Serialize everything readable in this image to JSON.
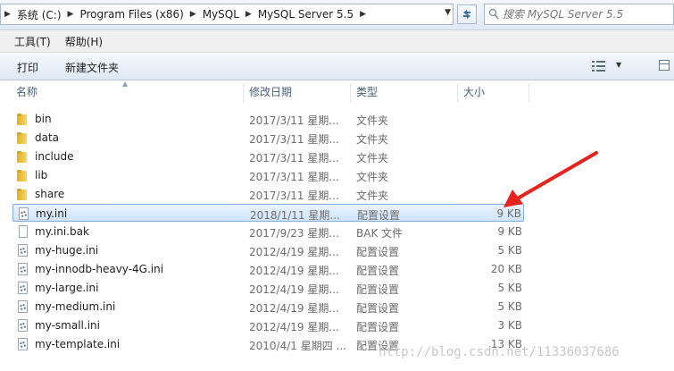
{
  "address_bar": {
    "crumbs": [
      "系统 (C:)",
      "Program Files (x86)",
      "MySQL",
      "MySQL Server 5.5"
    ],
    "search_placeholder": "搜索 MySQL Server 5.5"
  },
  "menu": [
    "工具(T)",
    "帮助(H)"
  ],
  "toolbar": {
    "print_label": "打印",
    "new_folder_label": "新建文件夹"
  },
  "columns": {
    "name": "名称",
    "date": "修改日期",
    "type": "类型",
    "size": "大小"
  },
  "files": [
    {
      "icon": "folder-icon",
      "name": "bin",
      "date": "2017/3/11 星期...",
      "type": "文件夹",
      "size": ""
    },
    {
      "icon": "folder-icon",
      "name": "data",
      "date": "2017/3/11 星期...",
      "type": "文件夹",
      "size": ""
    },
    {
      "icon": "folder-icon",
      "name": "include",
      "date": "2017/3/11 星期...",
      "type": "文件夹",
      "size": ""
    },
    {
      "icon": "folder-icon",
      "name": "lib",
      "date": "2017/3/11 星期...",
      "type": "文件夹",
      "size": ""
    },
    {
      "icon": "folder-icon",
      "name": "share",
      "date": "2017/3/11 星期...",
      "type": "文件夹",
      "size": ""
    },
    {
      "icon": "settings-file-icon",
      "name": "my.ini",
      "date": "2018/1/11 星期...",
      "type": "配置设置",
      "size": "9 KB",
      "selected": true
    },
    {
      "icon": "file-icon",
      "name": "my.ini.bak",
      "date": "2017/9/23 星期...",
      "type": "BAK 文件",
      "size": "9 KB"
    },
    {
      "icon": "settings-file-icon",
      "name": "my-huge.ini",
      "date": "2012/4/19 星期...",
      "type": "配置设置",
      "size": "5 KB"
    },
    {
      "icon": "settings-file-icon",
      "name": "my-innodb-heavy-4G.ini",
      "date": "2012/4/19 星期...",
      "type": "配置设置",
      "size": "20 KB"
    },
    {
      "icon": "settings-file-icon",
      "name": "my-large.ini",
      "date": "2012/4/19 星期...",
      "type": "配置设置",
      "size": "5 KB"
    },
    {
      "icon": "settings-file-icon",
      "name": "my-medium.ini",
      "date": "2012/4/19 星期...",
      "type": "配置设置",
      "size": "5 KB"
    },
    {
      "icon": "settings-file-icon",
      "name": "my-small.ini",
      "date": "2012/4/19 星期...",
      "type": "配置设置",
      "size": "3 KB"
    },
    {
      "icon": "settings-file-icon",
      "name": "my-template.ini",
      "date": "2010/4/1 星期四 ...",
      "type": "配置设置",
      "size": "13 KB"
    }
  ],
  "watermark": "http://blog.csdn.net/11336037686",
  "colors": {
    "selection_border": "#84acdd",
    "header_text": "#4c607a",
    "annotation_arrow": "#e8221c"
  }
}
